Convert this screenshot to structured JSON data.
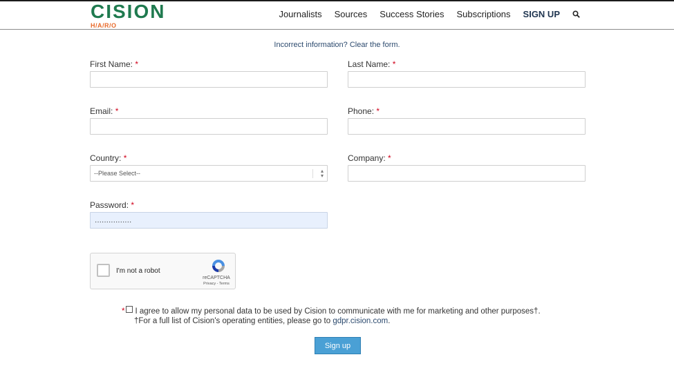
{
  "header": {
    "logo_main": "CISION",
    "logo_sub": "H/A/R/O",
    "nav": [
      "Journalists",
      "Sources",
      "Success Stories",
      "Subscriptions",
      "SIGN UP"
    ],
    "search_icon": "search-icon"
  },
  "form": {
    "clear_link": "Incorrect information? Clear the form.",
    "required_mark": "*",
    "first_name_label": "First Name:",
    "last_name_label": "Last Name:",
    "email_label": "Email:",
    "phone_label": "Phone:",
    "country_label": "Country:",
    "country_value": "--Please Select--",
    "company_label": "Company:",
    "password_label": "Password:",
    "password_value": "················",
    "captcha_label": "I'm not a robot",
    "captcha_brand": "reCAPTCHA",
    "captcha_links": "Privacy - Terms",
    "consent_text": "I agree to allow my personal data to be used by Cision to communicate with me for marketing and other purposes†.",
    "entities_text": "†For a full list of Cision's operating entities, please go to",
    "entities_link": "gdpr.cision.com",
    "entities_end": ".",
    "submit_label": "Sign up"
  },
  "colors": {
    "brand_green": "#1f7a4f",
    "brand_orange": "#e86a2a",
    "accent_blue": "#4aa0d5",
    "required_red": "#d0021b"
  }
}
